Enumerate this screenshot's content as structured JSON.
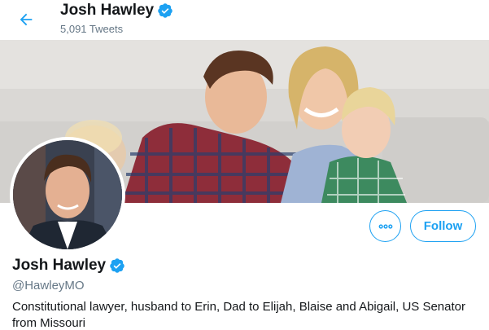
{
  "header": {
    "name": "Josh Hawley",
    "tweet_count": "5,091 Tweets",
    "verified_icon": "verified-badge-icon",
    "back_icon": "arrow-left-icon"
  },
  "banner": {
    "description": "profile-banner-photo"
  },
  "profile": {
    "name": "Josh Hawley",
    "handle": "@HawleyMO",
    "bio": "Constitutional lawyer, husband to Erin, Dad to Elijah, Blaise and Abigail, US Senator from Missouri"
  },
  "actions": {
    "more_icon": "more-horizontal-icon",
    "follow_label": "Follow"
  },
  "colors": {
    "accent": "#1da1f2",
    "text_primary": "#14171a",
    "text_secondary": "#657786"
  }
}
